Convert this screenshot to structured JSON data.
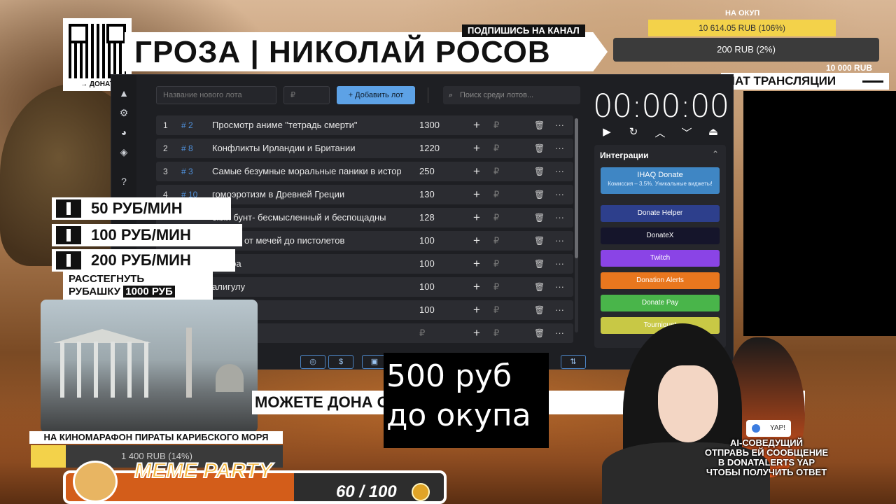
{
  "header": {
    "title": "ГРОЗА | НИКОЛАЙ РОСОВ",
    "subscribe": "ПОДПИШИСЬ НА КАНАЛ",
    "qr_label": "→ ДОНАТ"
  },
  "goals": {
    "caption": "НА ОКУП",
    "goal1": "10 614.05 RUB (106%)",
    "goal2": "200 RUB (2%)",
    "goal2_max": "10 000 RUB"
  },
  "chat": {
    "label": "ЧАТ ТРАНСЛЯЦИИ"
  },
  "app": {
    "new_lot_placeholder": "Название нового лота",
    "amount_placeholder": "₽",
    "add_button": "+ Добавить лот",
    "search_placeholder": "Поиск среди лотов...",
    "lots": [
      {
        "idx": "1",
        "tag": "# 2",
        "name": "Просмотр аниме \"тетрадь смерти\"",
        "amount": "1300"
      },
      {
        "idx": "2",
        "tag": "# 8",
        "name": "Конфликты Ирландии и Британии",
        "amount": "1220"
      },
      {
        "idx": "3",
        "tag": "# 3",
        "name": "Самые безумные моральные паники в истор",
        "amount": "250"
      },
      {
        "idx": "4",
        "tag": "# 10",
        "name": "гомоэротизм в Древней Греции",
        "amount": "130"
      },
      {
        "idx": "",
        "tag": "",
        "name": "ский бунт- бесмысленный и беспощадны",
        "amount": "128"
      },
      {
        "idx": "",
        "tag": "",
        "name": "дуэлей от мечей до пистолетов",
        "amount": "100"
      },
      {
        "idx": "",
        "tag": "",
        "name": "опатра",
        "amount": "100"
      },
      {
        "idx": "",
        "tag": "",
        "name": "алигулу",
        "amount": "100"
      },
      {
        "idx": "",
        "tag": "",
        "name": "нки",
        "amount": "100"
      },
      {
        "idx": "",
        "tag": "",
        "name": "",
        "amount": "₽"
      }
    ],
    "rub_symbol": "₽",
    "plus_symbol": "+",
    "more_symbol": "···",
    "timer": "00:00:00",
    "integrations_title": "Интеграции",
    "ihaq_title": "IHAQ Donate",
    "ihaq_sub": "Комиссия – 3,5%. Уникальные виджеты!",
    "services": [
      {
        "label": "Donate Helper",
        "color": "#2d3f8c"
      },
      {
        "label": "DonateX",
        "color": "#15152b"
      },
      {
        "label": "Twitch",
        "color": "#8a44e6"
      },
      {
        "label": "Donation Alerts",
        "color": "#e9771e"
      },
      {
        "label": "Donate Pay",
        "color": "#49b54a"
      },
      {
        "label": "Tourniquet",
        "color": "#c8c845"
      }
    ]
  },
  "tiers": [
    {
      "label": "50 РУБ/МИН"
    },
    {
      "label": "100 РУБ/МИН"
    },
    {
      "label": "200 РУБ/МИН"
    }
  ],
  "shirt": {
    "line1": "РАССТЕГНУТЬ",
    "line2": "РУБАШКУ",
    "price": "1000 РУБ"
  },
  "marathon": {
    "label": "НА КИНОМАРАФОН ПИРАТЫ КАРИБСКОГО МОРЯ",
    "value": "1 400 RUB (14%)",
    "progress": 0.14
  },
  "meme": {
    "title": "MEME PARTY",
    "count": "60 / 100"
  },
  "ticker": "МОЖЕТЕ ДОНА                    ОТНО СВОБ           ЗАК",
  "okup_box": {
    "line1": "500 руб",
    "line2": "до окупа"
  },
  "yap": {
    "badge": "YAP!",
    "line1": "AI-СОВЕДУЩИЙ",
    "line2": "ОТПРАВЬ ЕЙ СООБЩЕНИЕ",
    "line3": "В DONATALERTS YAP",
    "line4": "ЧТОБЫ ПОЛУЧИТЬ ОТВЕТ"
  }
}
